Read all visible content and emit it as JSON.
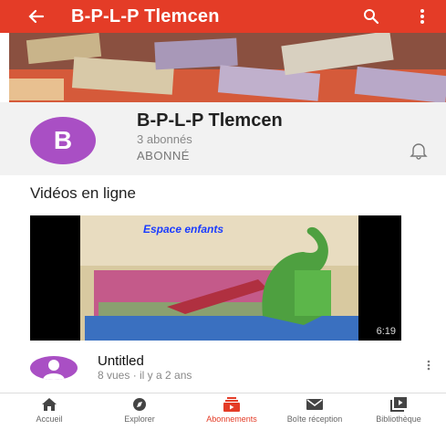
{
  "appbar": {
    "title": "B-P-L-P Tlemcen",
    "icons": [
      "back-arrow-icon",
      "search-icon",
      "more-vertical-icon"
    ]
  },
  "channel": {
    "avatar_letter": "B",
    "name": "B-P-L-P Tlemcen",
    "subscribers": "3 abonnés",
    "status": "ABONNÉ",
    "icon": "bell-icon"
  },
  "section": {
    "title": "Vidéos en ligne"
  },
  "video": {
    "thumbnail_text": "Espace enfants",
    "duration": "6:19",
    "title": "Untitled",
    "meta": "8 vues · il y a 2 ans"
  },
  "nav": {
    "items": [
      {
        "label": "Accueil",
        "icon": "home-icon"
      },
      {
        "label": "Explorer",
        "icon": "compass-icon"
      },
      {
        "label": "Abonnements",
        "icon": "subscriptions-icon"
      },
      {
        "label": "Boîte réception",
        "icon": "inbox-icon"
      },
      {
        "label": "Bibliothèque",
        "icon": "library-icon"
      }
    ],
    "active_index": 2
  },
  "colors": {
    "brand": "#e43c27",
    "avatar": "#a94fc4"
  }
}
